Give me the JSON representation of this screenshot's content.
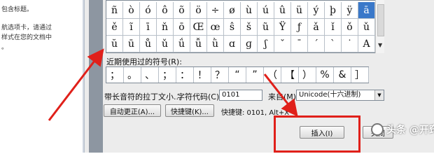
{
  "left_panel": {
    "lines": [
      "包含标题。",
      "",
      "航选项卡，请通过",
      "样式在您的文档中",
      "。"
    ]
  },
  "symbol_grid": {
    "rows": [
      [
        "ñ",
        "ò",
        "ó",
        "ô",
        "õ",
        "ö",
        "÷",
        "ø",
        "ù",
        "ú",
        "û",
        "ü",
        "ý",
        "þ",
        "ÿ",
        "ā"
      ],
      [
        "ě",
        "ĩ",
        "ī",
        "ň",
        "ō",
        "Œ",
        "œ",
        "ŝ",
        "š",
        "ũ",
        "Ÿ",
        "ƒ",
        "ǎ",
        "ǐ",
        "ǒ",
        "ǔ"
      ],
      [
        "ŭ",
        "ū",
        "ů",
        "ǔ",
        "ǘ",
        "ǚ",
        "ǜ",
        "ɑ",
        "ɡ",
        "ʃ",
        "ˇ",
        "ˉ",
        "ˊ",
        "ˋ",
        "˙",
        "A"
      ]
    ],
    "selected": "ā"
  },
  "recent": {
    "label": "近期使用过的符号(R):",
    "symbols": [
      "；",
      "。",
      "、",
      "；",
      "：",
      "！",
      "？",
      "“",
      "”",
      "（",
      "【",
      "）",
      "%",
      "&",
      "］"
    ]
  },
  "char_name": "带长音符的拉丁文小...",
  "char_code_label": "字符代码(C):",
  "char_code_value": "0101",
  "from_label": "来自(M):",
  "from_value": "Unicode(十六进制)",
  "autocorrect_button": "自动更正(A)...",
  "shortcut_key_button": "快捷键(K)...",
  "shortcut_text": "快捷键: 0101, Alt+X",
  "insert_button": "插入(I)",
  "cancel_button": "关闭",
  "watermark": "头条 @开窍",
  "colors": {
    "highlight": "#3a78c9",
    "annotation_red": "#e0201a"
  }
}
